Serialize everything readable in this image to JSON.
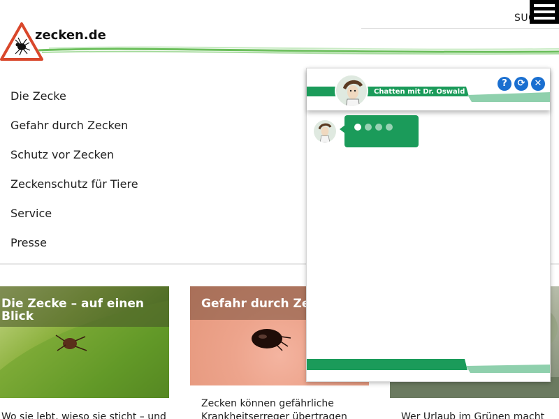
{
  "header": {
    "logo_text": "zecken.de",
    "search_label": "SUC",
    "menu_label": "menu-icon"
  },
  "nav": {
    "items": [
      {
        "label": "Die Zecke"
      },
      {
        "label": "Gefahr durch Zecken"
      },
      {
        "label": "Schutz vor Zecken"
      },
      {
        "label": "Zeckenschutz für Tiere"
      },
      {
        "label": "Service"
      },
      {
        "label": "Presse"
      }
    ]
  },
  "cards": [
    {
      "title": "Die Zecke – auf einen Blick",
      "caption": "Wo sie lebt, wieso sie sticht – und"
    },
    {
      "title": "Gefahr durch Zec",
      "caption_line1": "Zecken können gefährliche",
      "caption_line2": "Krankheitserreger übertragen"
    },
    {
      "title": "",
      "caption": "Wer Urlaub im Grünen macht"
    }
  ],
  "chat": {
    "title": "Chatten mit Dr. Oswald",
    "help_glyph": "?",
    "refresh_glyph": "⟳",
    "close_glyph": "✕",
    "typing_dots": 4
  },
  "colors": {
    "accent_green": "#1b9b5a",
    "light_green": "#8fd0ad",
    "control_blue": "#1a6fd0",
    "warning_red": "#d9472b"
  }
}
